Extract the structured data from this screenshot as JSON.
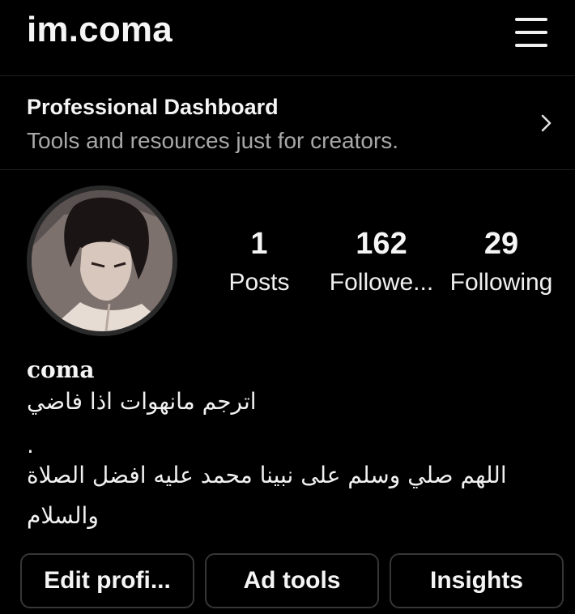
{
  "header": {
    "username": "im.coma",
    "menu_icon": "hamburger-menu-icon"
  },
  "dashboard": {
    "title": "Professional Dashboard",
    "subtitle": "Tools and resources just for creators.",
    "chevron_icon": "chevron-right-icon"
  },
  "profile": {
    "avatar": "anime-character-avatar",
    "stats": [
      {
        "value": "1",
        "label": "Posts"
      },
      {
        "value": "162",
        "label": "Followe..."
      },
      {
        "value": "29",
        "label": "Following"
      }
    ],
    "name": "coma",
    "bio": [
      "اترجم مانهوات اذا فاضي",
      ".",
      "اللهم صلي وسلم على نبينا محمد عليه افضل الصلاة",
      "والسلام"
    ]
  },
  "actions": {
    "edit_profile": "Edit profi...",
    "ad_tools": "Ad tools",
    "insights": "Insights"
  },
  "colors": {
    "background": "#000000",
    "text_primary": "#f5f5f5",
    "text_secondary": "#a8a8a8",
    "button_border": "#363636"
  }
}
